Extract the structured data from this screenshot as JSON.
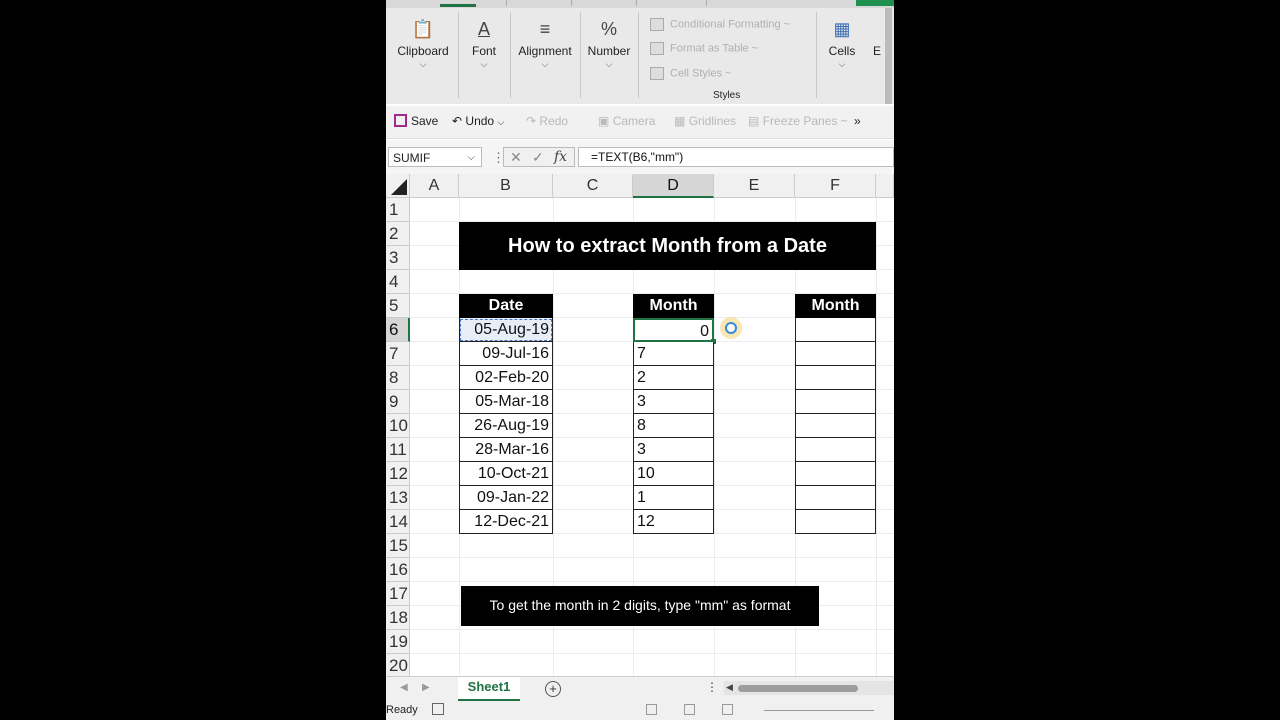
{
  "ribbon": {
    "groups": [
      {
        "label": "Clipboard",
        "icon": "clipboard-icon"
      },
      {
        "label": "Font",
        "icon": "font-color-icon"
      },
      {
        "label": "Alignment",
        "icon": "align-icon"
      },
      {
        "label": "Number",
        "icon": "percent-icon"
      }
    ],
    "styles_items": [
      "Conditional Formatting ~",
      "Format as Table ~",
      "Cell Styles ~"
    ],
    "styles_label": "Styles",
    "cells_label": "Cells",
    "editing_label_partial": "E"
  },
  "qat": {
    "save": "Save",
    "undo": "Undo",
    "redo": "Redo",
    "camera": "Camera",
    "gridlines": "Gridlines",
    "freeze": "Freeze Panes ~",
    "more": "»"
  },
  "formula_bar": {
    "name_box": "SUMIF",
    "formula": "=TEXT(B6,\"mm\")",
    "fx": "fx"
  },
  "columns": [
    "A",
    "B",
    "C",
    "D",
    "E",
    "F"
  ],
  "rows": [
    "1",
    "2",
    "3",
    "4",
    "5",
    "6",
    "7",
    "8",
    "9",
    "10",
    "11",
    "12",
    "13",
    "14",
    "15",
    "16",
    "17",
    "18",
    "19",
    "20"
  ],
  "sheet": {
    "title": "How to extract Month from a Date",
    "headers": {
      "date": "Date",
      "month1": "Month",
      "month2": "Month"
    },
    "dates": [
      "05-Aug-19",
      "09-Jul-16",
      "02-Feb-20",
      "05-Mar-18",
      "26-Aug-19",
      "28-Mar-16",
      "10-Oct-21",
      "09-Jan-22",
      "12-Dec-21"
    ],
    "months": [
      "0",
      "7",
      "2",
      "3",
      "8",
      "3",
      "10",
      "1",
      "12"
    ],
    "tip": "To get the month in 2 digits, type \"mm\" as format"
  },
  "tabs": {
    "sheet1": "Sheet1",
    "add": "+"
  },
  "status": {
    "ready": "Ready"
  }
}
